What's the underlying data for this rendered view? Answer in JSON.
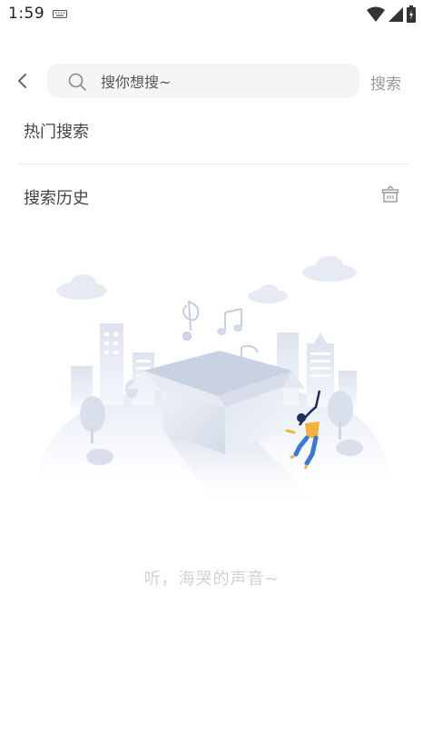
{
  "status_bar": {
    "time": "1:59",
    "icons": [
      "keyboard-icon",
      "wifi-icon",
      "signal-icon",
      "battery-icon"
    ]
  },
  "header": {
    "back_icon": "chevron-left-icon",
    "search": {
      "placeholder": "搜你想搜~",
      "value": "",
      "icon": "search-icon"
    },
    "search_button": "搜索"
  },
  "sections": {
    "hot_search_title": "热门搜索",
    "history_title": "搜索历史",
    "clear_history_icon": "trash-basket-icon"
  },
  "empty_state": {
    "illustration": "open-box-music-notes-illustration",
    "text": "听，海哭的声音~"
  },
  "colors": {
    "placeholder_text": "#555555",
    "search_bg": "#f4f5f7",
    "muted": "#9a9a9a",
    "empty_text": "#cfd2d8"
  }
}
